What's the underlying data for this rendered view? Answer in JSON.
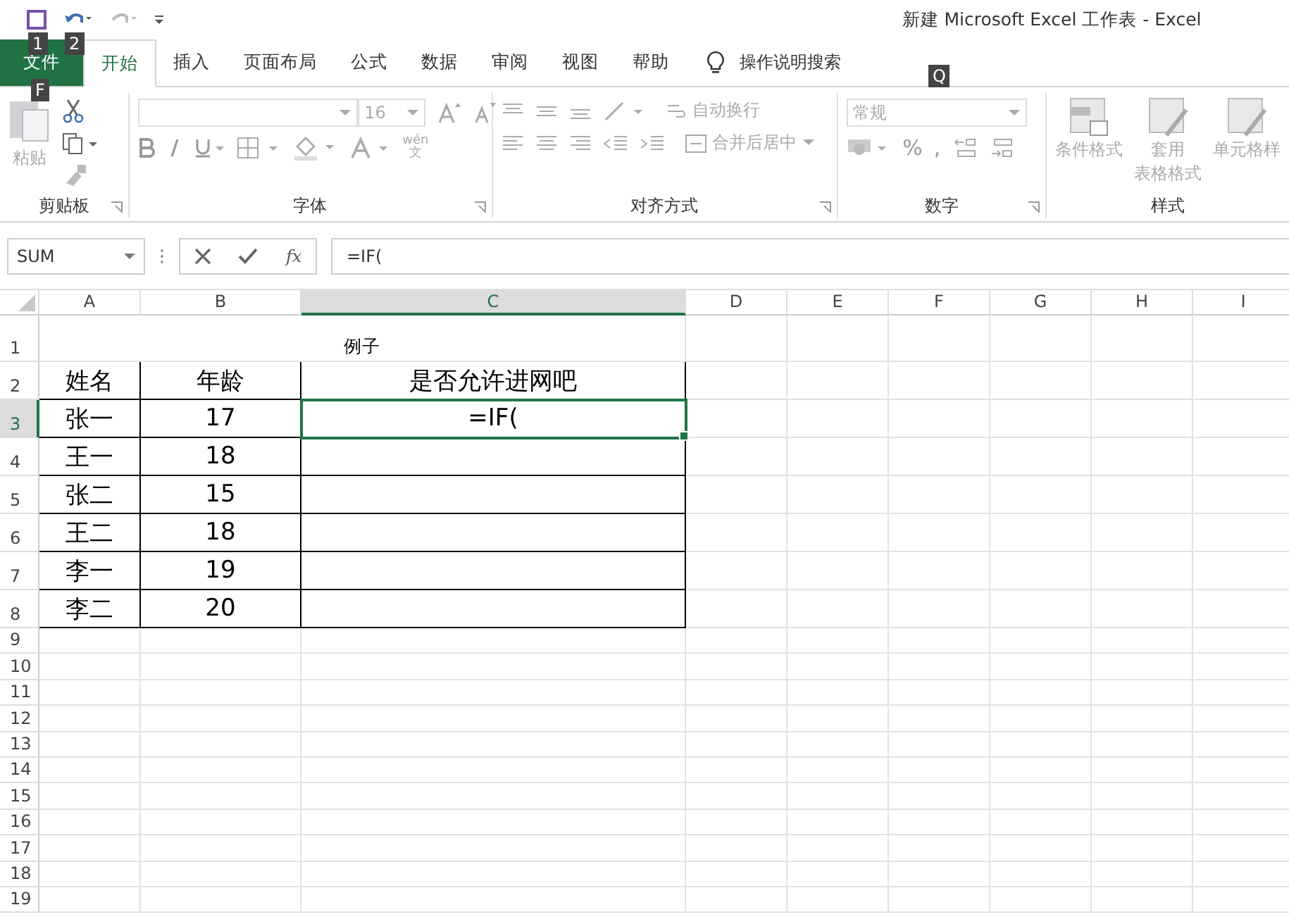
{
  "window": {
    "title": "新建 Microsoft Excel 工作表  -  Excel"
  },
  "quick_access": {
    "keytips": [
      "1",
      "2"
    ]
  },
  "tabs": [
    {
      "label": "文件",
      "kind": "file",
      "selected": false,
      "keytip": "F"
    },
    {
      "label": "开始",
      "kind": "tab",
      "selected": true
    },
    {
      "label": "插入",
      "kind": "tab",
      "selected": false
    },
    {
      "label": "页面布局",
      "kind": "tab",
      "selected": false
    },
    {
      "label": "公式",
      "kind": "tab",
      "selected": false
    },
    {
      "label": "数据",
      "kind": "tab",
      "selected": false
    },
    {
      "label": "审阅",
      "kind": "tab",
      "selected": false
    },
    {
      "label": "视图",
      "kind": "tab",
      "selected": false
    },
    {
      "label": "帮助",
      "kind": "tab",
      "selected": false
    }
  ],
  "tell_me": {
    "label": "操作说明搜索",
    "keytip": "Q"
  },
  "ribbon": {
    "disabled": true,
    "clipboard": {
      "paste": "粘贴",
      "group": "剪贴板"
    },
    "font": {
      "font_size": "16",
      "phonetic": "文",
      "phonetic_top": "wén",
      "group": "字体"
    },
    "alignment": {
      "wrap": "自动换行",
      "merge": "合并后居中",
      "group": "对齐方式"
    },
    "number": {
      "format": "常规",
      "percent": "%",
      "comma": ",",
      "group": "数字"
    },
    "styles": {
      "conditional": "条件格式",
      "table": [
        "套用",
        "表格格式"
      ],
      "cell": "单元格样",
      "group": "样式"
    }
  },
  "formula_bar": {
    "name_box": "SUM",
    "fx": "fx",
    "value": "=IF("
  },
  "columns": [
    {
      "label": "A",
      "selected": false
    },
    {
      "label": "B",
      "selected": false
    },
    {
      "label": "C",
      "selected": true
    },
    {
      "label": "D",
      "selected": false
    },
    {
      "label": "E",
      "selected": false
    },
    {
      "label": "F",
      "selected": false
    },
    {
      "label": "G",
      "selected": false
    },
    {
      "label": "H",
      "selected": false
    },
    {
      "label": "I",
      "selected": false
    }
  ],
  "rows": [
    {
      "header": "1",
      "kind": "title",
      "selected": false,
      "title": "例子"
    },
    {
      "header": "2",
      "kind": "data",
      "selected": false,
      "cells": [
        {
          "text": "姓名",
          "selected": false
        },
        {
          "text": "年龄",
          "selected": false
        },
        {
          "text": "是否允许进网吧",
          "selected": false
        }
      ]
    },
    {
      "header": "3",
      "kind": "data",
      "selected": true,
      "cells": [
        {
          "text": "张一",
          "selected": false
        },
        {
          "text": "17",
          "selected": false
        },
        {
          "text": "=IF(",
          "selected": true
        }
      ]
    },
    {
      "header": "4",
      "kind": "data",
      "selected": false,
      "cells": [
        {
          "text": "王一",
          "selected": false
        },
        {
          "text": "18",
          "selected": false
        },
        {
          "text": "",
          "selected": false
        }
      ]
    },
    {
      "header": "5",
      "kind": "data",
      "selected": false,
      "cells": [
        {
          "text": "张二",
          "selected": false
        },
        {
          "text": "15",
          "selected": false
        },
        {
          "text": "",
          "selected": false
        }
      ]
    },
    {
      "header": "6",
      "kind": "data",
      "selected": false,
      "cells": [
        {
          "text": "王二",
          "selected": false
        },
        {
          "text": "18",
          "selected": false
        },
        {
          "text": "",
          "selected": false
        }
      ]
    },
    {
      "header": "7",
      "kind": "data",
      "selected": false,
      "cells": [
        {
          "text": "李一",
          "selected": false
        },
        {
          "text": "19",
          "selected": false
        },
        {
          "text": "",
          "selected": false
        }
      ]
    },
    {
      "header": "8",
      "kind": "data",
      "selected": false,
      "cells": [
        {
          "text": "李二",
          "selected": false
        },
        {
          "text": "20",
          "selected": false
        },
        {
          "text": "",
          "selected": false
        }
      ]
    },
    {
      "header": "9",
      "kind": "blank",
      "selected": false
    },
    {
      "header": "10",
      "kind": "blank",
      "selected": false
    },
    {
      "header": "11",
      "kind": "blank",
      "selected": false
    },
    {
      "header": "12",
      "kind": "blank",
      "selected": false
    },
    {
      "header": "13",
      "kind": "blank",
      "selected": false
    },
    {
      "header": "14",
      "kind": "blank",
      "selected": false
    },
    {
      "header": "15",
      "kind": "blank",
      "selected": false
    },
    {
      "header": "16",
      "kind": "blank",
      "selected": false
    },
    {
      "header": "17",
      "kind": "blank",
      "selected": false
    },
    {
      "header": "18",
      "kind": "blank",
      "selected": false
    },
    {
      "header": "19",
      "kind": "blank",
      "selected": false
    }
  ]
}
